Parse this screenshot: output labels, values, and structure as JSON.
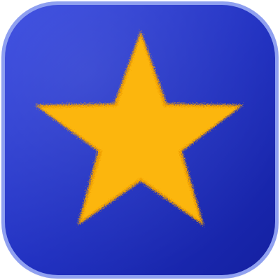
{
  "app_icon": {
    "icon": "star-icon",
    "colors": {
      "tile_base": "#1f2fbf",
      "tile_light": "#3547e0",
      "tile_dark": "#1420a0",
      "rim": "#8fa0f0",
      "star_fill": "#fcb60d",
      "star_edge": "#f0a000"
    }
  }
}
